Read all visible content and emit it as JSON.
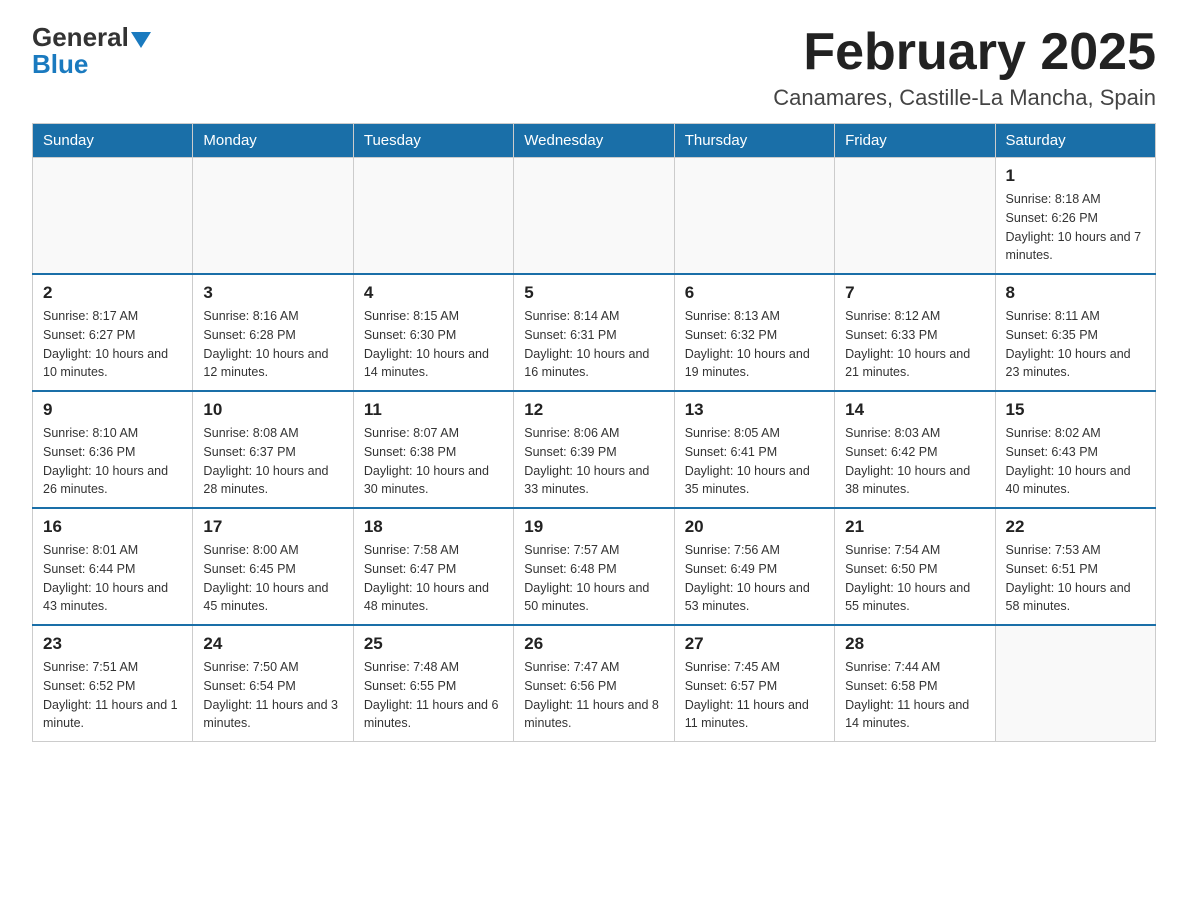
{
  "logo": {
    "general": "General",
    "blue": "Blue"
  },
  "title": "February 2025",
  "location": "Canamares, Castille-La Mancha, Spain",
  "weekdays": [
    "Sunday",
    "Monday",
    "Tuesday",
    "Wednesday",
    "Thursday",
    "Friday",
    "Saturday"
  ],
  "weeks": [
    [
      {
        "day": "",
        "info": ""
      },
      {
        "day": "",
        "info": ""
      },
      {
        "day": "",
        "info": ""
      },
      {
        "day": "",
        "info": ""
      },
      {
        "day": "",
        "info": ""
      },
      {
        "day": "",
        "info": ""
      },
      {
        "day": "1",
        "info": "Sunrise: 8:18 AM\nSunset: 6:26 PM\nDaylight: 10 hours and 7 minutes."
      }
    ],
    [
      {
        "day": "2",
        "info": "Sunrise: 8:17 AM\nSunset: 6:27 PM\nDaylight: 10 hours and 10 minutes."
      },
      {
        "day": "3",
        "info": "Sunrise: 8:16 AM\nSunset: 6:28 PM\nDaylight: 10 hours and 12 minutes."
      },
      {
        "day": "4",
        "info": "Sunrise: 8:15 AM\nSunset: 6:30 PM\nDaylight: 10 hours and 14 minutes."
      },
      {
        "day": "5",
        "info": "Sunrise: 8:14 AM\nSunset: 6:31 PM\nDaylight: 10 hours and 16 minutes."
      },
      {
        "day": "6",
        "info": "Sunrise: 8:13 AM\nSunset: 6:32 PM\nDaylight: 10 hours and 19 minutes."
      },
      {
        "day": "7",
        "info": "Sunrise: 8:12 AM\nSunset: 6:33 PM\nDaylight: 10 hours and 21 minutes."
      },
      {
        "day": "8",
        "info": "Sunrise: 8:11 AM\nSunset: 6:35 PM\nDaylight: 10 hours and 23 minutes."
      }
    ],
    [
      {
        "day": "9",
        "info": "Sunrise: 8:10 AM\nSunset: 6:36 PM\nDaylight: 10 hours and 26 minutes."
      },
      {
        "day": "10",
        "info": "Sunrise: 8:08 AM\nSunset: 6:37 PM\nDaylight: 10 hours and 28 minutes."
      },
      {
        "day": "11",
        "info": "Sunrise: 8:07 AM\nSunset: 6:38 PM\nDaylight: 10 hours and 30 minutes."
      },
      {
        "day": "12",
        "info": "Sunrise: 8:06 AM\nSunset: 6:39 PM\nDaylight: 10 hours and 33 minutes."
      },
      {
        "day": "13",
        "info": "Sunrise: 8:05 AM\nSunset: 6:41 PM\nDaylight: 10 hours and 35 minutes."
      },
      {
        "day": "14",
        "info": "Sunrise: 8:03 AM\nSunset: 6:42 PM\nDaylight: 10 hours and 38 minutes."
      },
      {
        "day": "15",
        "info": "Sunrise: 8:02 AM\nSunset: 6:43 PM\nDaylight: 10 hours and 40 minutes."
      }
    ],
    [
      {
        "day": "16",
        "info": "Sunrise: 8:01 AM\nSunset: 6:44 PM\nDaylight: 10 hours and 43 minutes."
      },
      {
        "day": "17",
        "info": "Sunrise: 8:00 AM\nSunset: 6:45 PM\nDaylight: 10 hours and 45 minutes."
      },
      {
        "day": "18",
        "info": "Sunrise: 7:58 AM\nSunset: 6:47 PM\nDaylight: 10 hours and 48 minutes."
      },
      {
        "day": "19",
        "info": "Sunrise: 7:57 AM\nSunset: 6:48 PM\nDaylight: 10 hours and 50 minutes."
      },
      {
        "day": "20",
        "info": "Sunrise: 7:56 AM\nSunset: 6:49 PM\nDaylight: 10 hours and 53 minutes."
      },
      {
        "day": "21",
        "info": "Sunrise: 7:54 AM\nSunset: 6:50 PM\nDaylight: 10 hours and 55 minutes."
      },
      {
        "day": "22",
        "info": "Sunrise: 7:53 AM\nSunset: 6:51 PM\nDaylight: 10 hours and 58 minutes."
      }
    ],
    [
      {
        "day": "23",
        "info": "Sunrise: 7:51 AM\nSunset: 6:52 PM\nDaylight: 11 hours and 1 minute."
      },
      {
        "day": "24",
        "info": "Sunrise: 7:50 AM\nSunset: 6:54 PM\nDaylight: 11 hours and 3 minutes."
      },
      {
        "day": "25",
        "info": "Sunrise: 7:48 AM\nSunset: 6:55 PM\nDaylight: 11 hours and 6 minutes."
      },
      {
        "day": "26",
        "info": "Sunrise: 7:47 AM\nSunset: 6:56 PM\nDaylight: 11 hours and 8 minutes."
      },
      {
        "day": "27",
        "info": "Sunrise: 7:45 AM\nSunset: 6:57 PM\nDaylight: 11 hours and 11 minutes."
      },
      {
        "day": "28",
        "info": "Sunrise: 7:44 AM\nSunset: 6:58 PM\nDaylight: 11 hours and 14 minutes."
      },
      {
        "day": "",
        "info": ""
      }
    ]
  ]
}
